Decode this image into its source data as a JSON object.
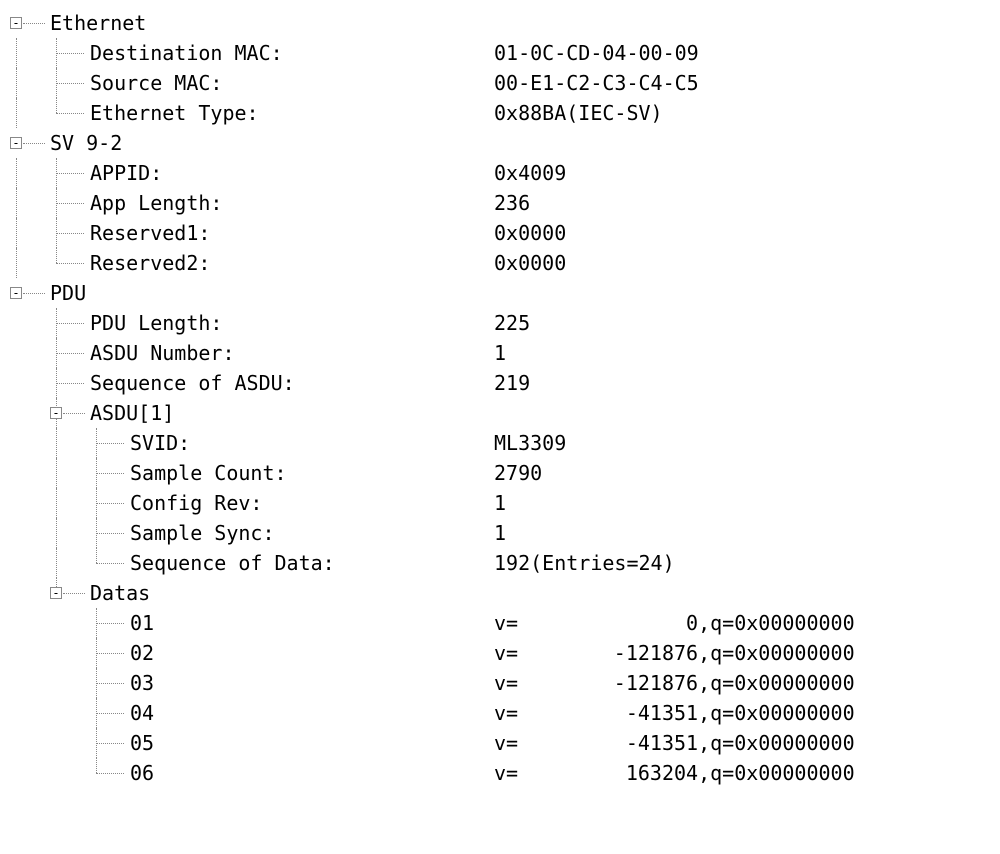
{
  "nodes": {
    "ethernet": {
      "label": "Ethernet",
      "dest_mac": {
        "label": "Destination MAC:",
        "value": "01-0C-CD-04-00-09"
      },
      "src_mac": {
        "label": "Source MAC:",
        "value": "00-E1-C2-C3-C4-C5"
      },
      "eth_type": {
        "label": "Ethernet Type:",
        "value": "0x88BA(IEC-SV)"
      }
    },
    "sv92": {
      "label": "SV 9-2",
      "appid": {
        "label": "APPID:",
        "value": "0x4009"
      },
      "applen": {
        "label": "App Length:",
        "value": "236"
      },
      "res1": {
        "label": "Reserved1:",
        "value": "0x0000"
      },
      "res2": {
        "label": "Reserved2:",
        "value": "0x0000"
      }
    },
    "pdu": {
      "label": "PDU",
      "pdulen": {
        "label": "PDU Length:",
        "value": "225"
      },
      "asdunum": {
        "label": "ASDU Number:",
        "value": "1"
      },
      "seqasdu": {
        "label": "Sequence of ASDU:",
        "value": "219"
      },
      "asdu1": {
        "label": "ASDU[1]",
        "svid": {
          "label": "SVID:",
          "value": "ML3309"
        },
        "smpcnt": {
          "label": "Sample Count:",
          "value": "2790"
        },
        "cfgrev": {
          "label": "Config Rev:",
          "value": "1"
        },
        "smpsync": {
          "label": "Sample Sync:",
          "value": "1"
        },
        "seqdata": {
          "label": "Sequence of Data:",
          "value": "192(Entries=24)"
        }
      },
      "datas": {
        "label": "Datas",
        "items": [
          {
            "idx": "01",
            "v": "0",
            "q": "q=0x00000000"
          },
          {
            "idx": "02",
            "v": "-121876",
            "q": "q=0x00000000"
          },
          {
            "idx": "03",
            "v": "-121876",
            "q": "q=0x00000000"
          },
          {
            "idx": "04",
            "v": "-41351",
            "q": "q=0x00000000"
          },
          {
            "idx": "05",
            "v": "-41351",
            "q": "q=0x00000000"
          },
          {
            "idx": "06",
            "v": "163204",
            "q": "q=0x00000000"
          }
        ]
      }
    }
  },
  "glyphs": {
    "minus": "-",
    "vprefix": "v=",
    "comma": ", "
  }
}
